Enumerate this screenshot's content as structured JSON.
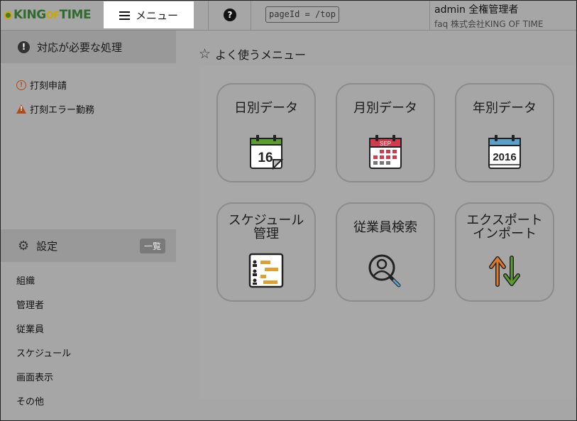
{
  "header": {
    "logo": {
      "part1": "KING",
      "part2": "OF",
      "part3": "TIME"
    },
    "menu_label": "メニュー",
    "help": "?",
    "page_id": "pageId = /top",
    "user_name": "admin 全権管理者",
    "user_company": "faq 株式会社KING OF TIME"
  },
  "sidebar": {
    "tasks_title": "対応が必要な処理",
    "task_items": [
      {
        "label": "打刻申請",
        "icon": "warning-circle-icon"
      },
      {
        "label": "打刻エラー勤務",
        "icon": "warning-triangle-icon"
      }
    ],
    "settings_title": "設定",
    "settings_badge": "一覧",
    "settings_items": [
      "組織",
      "管理者",
      "従業員",
      "スケジュール",
      "画面表示",
      "その他"
    ]
  },
  "main": {
    "title": "よく使うメニュー",
    "tiles": [
      {
        "line1": "日別データ",
        "line2": "",
        "icon": "calendar-day-icon",
        "icon_text": "16"
      },
      {
        "line1": "月別データ",
        "line2": "",
        "icon": "calendar-month-icon",
        "icon_text": "SEP"
      },
      {
        "line1": "年別データ",
        "line2": "",
        "icon": "calendar-year-icon",
        "icon_text": "2016"
      },
      {
        "line1": "スケジュール",
        "line2": "管理",
        "icon": "schedule-icon",
        "icon_text": ""
      },
      {
        "line1": "従業員検索",
        "line2": "",
        "icon": "employee-search-icon",
        "icon_text": ""
      },
      {
        "line1": "エクスポート",
        "line2": "インポート",
        "icon": "import-export-icon",
        "icon_text": ""
      }
    ]
  },
  "colors": {
    "green": "#5a9e2e",
    "red": "#d23a4e",
    "blue": "#5aa0c8",
    "orange": "#e07a2a",
    "schedule_bar": "#e0a030",
    "warning": "#b24a17"
  }
}
